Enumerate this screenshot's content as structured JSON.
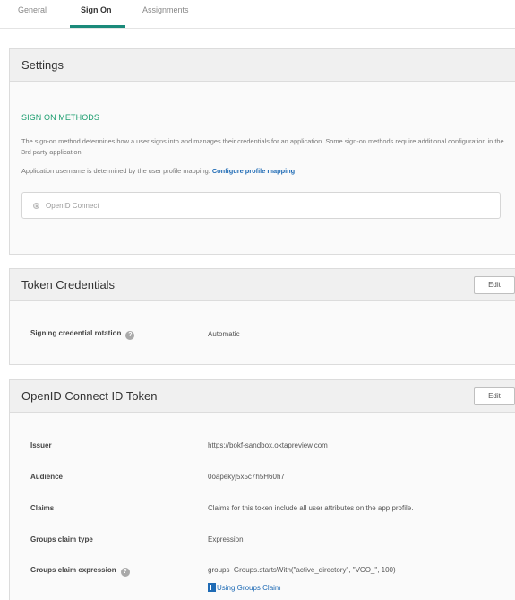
{
  "tabs": [
    {
      "label": "General"
    },
    {
      "label": "Sign On"
    },
    {
      "label": "Assignments"
    }
  ],
  "settings": {
    "title": "Settings",
    "section_title": "SIGN ON METHODS",
    "description": "The sign-on method determines how a user signs into and manages their credentials for an application. Some sign-on methods require additional configuration in the 3rd party application.",
    "username_text": "Application username is determined by the user profile mapping.",
    "configure_link": "Configure profile mapping",
    "option_label": "OpenID Connect"
  },
  "token_credentials": {
    "title": "Token Credentials",
    "edit_label": "Edit",
    "rows": [
      {
        "label": "Signing credential rotation",
        "value": "Automatic",
        "help": "?"
      }
    ]
  },
  "oidc_token": {
    "title": "OpenID Connect ID Token",
    "edit_label": "Edit",
    "rows": [
      {
        "label": "Issuer",
        "value": "https://bokf-sandbox.oktapreview.com"
      },
      {
        "label": "Audience",
        "value": "0oapekyj5x5c7h5H60h7"
      },
      {
        "label": "Claims",
        "value": "Claims for this token include all user attributes on the app profile."
      },
      {
        "label": "Groups claim type",
        "value": "Expression"
      },
      {
        "label": "Groups claim expression",
        "value": "groups  Groups.startsWith(\"active_directory\", \"VCO_\", 100)",
        "help": "?"
      }
    ],
    "doc_link": "Using Groups Claim"
  },
  "colors": {
    "accent": "#1a8a7a",
    "section_green": "#1a9d6e",
    "link_blue": "#1f6bb5"
  }
}
